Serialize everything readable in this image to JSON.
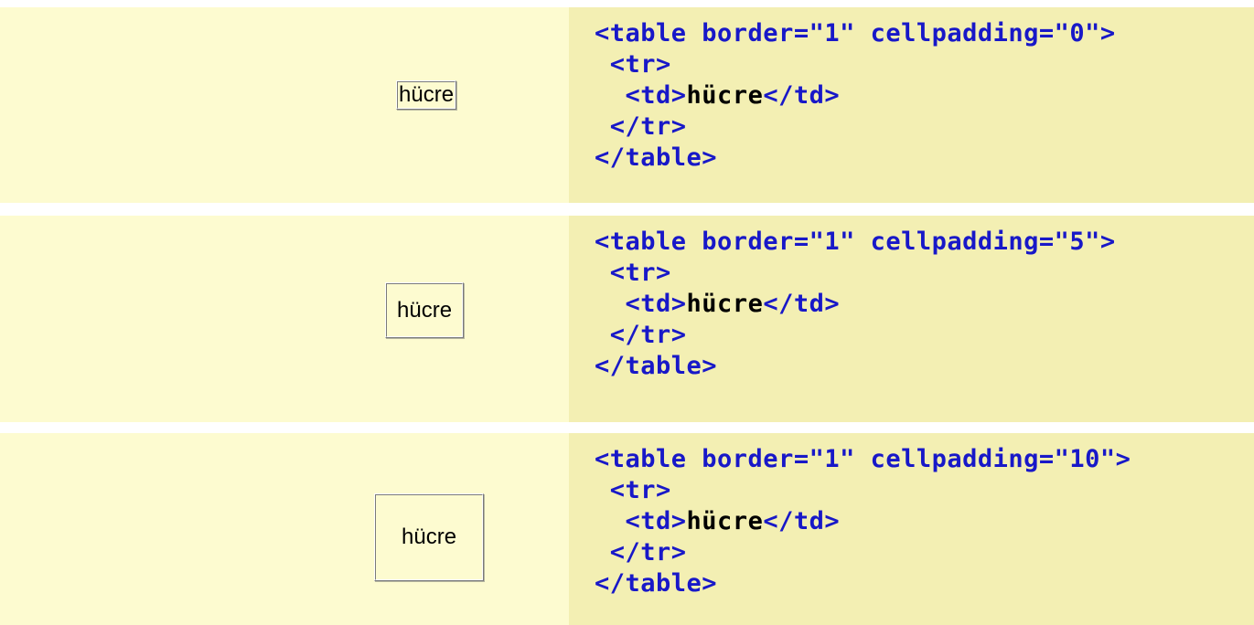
{
  "examples": [
    {
      "cell_text": "hücre",
      "code": {
        "line1": "<table border=\"1\" cellpadding=\"0\">",
        "line2": " <tr>",
        "line3_open": "  <td>",
        "line3_text": "hücre",
        "line3_close": "</td>",
        "line4": " </tr>",
        "line5": "</table>"
      }
    },
    {
      "cell_text": "hücre",
      "code": {
        "line1": "<table border=\"1\" cellpadding=\"5\">",
        "line2": " <tr>",
        "line3_open": "  <td>",
        "line3_text": "hücre",
        "line3_close": "</td>",
        "line4": " </tr>",
        "line5": "</table>"
      }
    },
    {
      "cell_text": "hücre",
      "code": {
        "line1": "<table border=\"1\" cellpadding=\"10\">",
        "line2": " <tr>",
        "line3_open": "  <td>",
        "line3_text": "hücre",
        "line3_close": "</td>",
        "line4": " </tr>",
        "line5": "</table>"
      }
    }
  ],
  "colors": {
    "preview_background": "#fdfbd0",
    "code_background": "#f3efb3",
    "code_tag_color": "#1818c8",
    "code_text_color": "#000000"
  }
}
